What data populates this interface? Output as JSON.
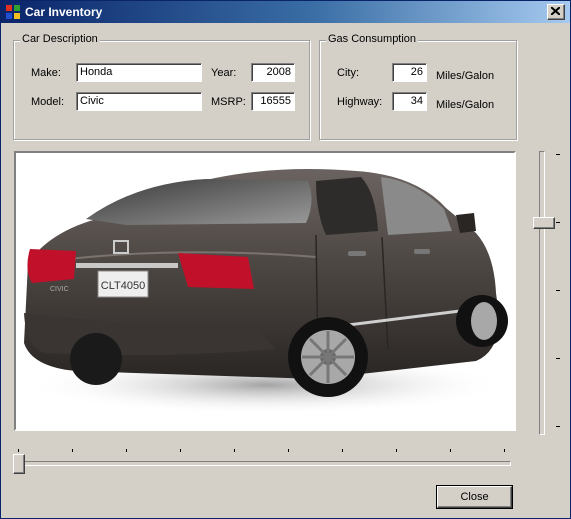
{
  "window": {
    "title": "Car Inventory"
  },
  "description": {
    "legend": "Car Description",
    "make_label": "Make:",
    "make_value": "Honda",
    "model_label": "Model:",
    "model_value": "Civic",
    "year_label": "Year:",
    "year_value": "2008",
    "msrp_label": "MSRP:",
    "msrp_value": "16555"
  },
  "gas": {
    "legend": "Gas Consumption",
    "city_label": "City:",
    "city_value": "26",
    "city_unit": "Miles/Galon",
    "highway_label": "Highway:",
    "highway_value": "34",
    "highway_unit": "Miles/Galon"
  },
  "picture": {
    "plate_text": "CLT4050",
    "badge_text": "CIVIC",
    "body_color": "#4a4440"
  },
  "vertical_slider": {
    "value_fraction": 0.25
  },
  "horizontal_slider": {
    "value_fraction": 0.0
  },
  "buttons": {
    "close": "Close"
  }
}
